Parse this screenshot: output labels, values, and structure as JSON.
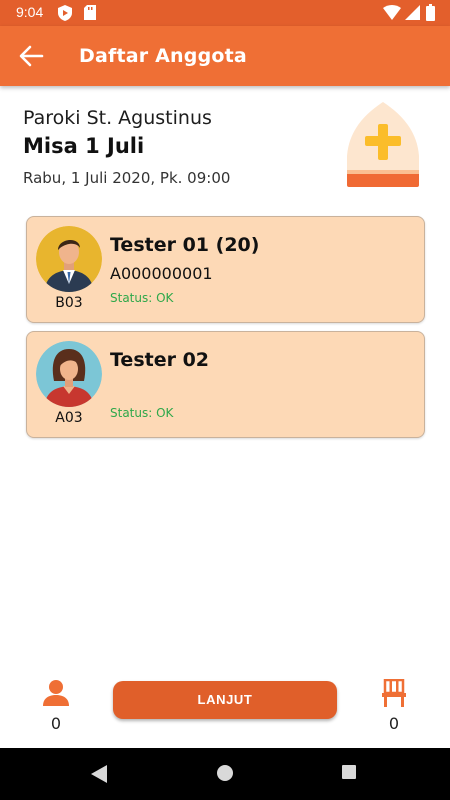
{
  "status_bar": {
    "time": "9:04",
    "left_icons": [
      "shield-play-icon",
      "sd-card-icon"
    ],
    "right_icons": [
      "wifi-icon",
      "signal-icon",
      "battery-icon"
    ]
  },
  "app_bar": {
    "back_icon": "arrow-left-icon",
    "title": "Daftar Anggota"
  },
  "event": {
    "parish": "Paroki St. Agustinus",
    "mass_name": "Misa 1 Juli",
    "datetime": "Rabu, 1 Juli 2020, Pk. 09:00",
    "icon": "bishop-mitre-icon"
  },
  "members": [
    {
      "name": "Tester 01 (20)",
      "id": "A000000001",
      "status": "Status: OK",
      "code": "B03",
      "avatar": "male-avatar"
    },
    {
      "name": "Tester 02",
      "id": "",
      "status": "Status: OK",
      "code": "A03",
      "avatar": "female-avatar"
    }
  ],
  "bottom": {
    "person_count": "0",
    "seat_count": "0",
    "button_label": "LANJUT"
  },
  "colors": {
    "status_bar": "#e35f2c",
    "app_bar": "#ef6f35",
    "card_bg": "#fdd9b6",
    "status_ok": "#2ea84a",
    "button": "#e05f2a",
    "accent_icon": "#ef6f35"
  },
  "nav_bar": {
    "icons": [
      "back-triangle-icon",
      "home-circle-icon",
      "recents-square-icon"
    ]
  }
}
